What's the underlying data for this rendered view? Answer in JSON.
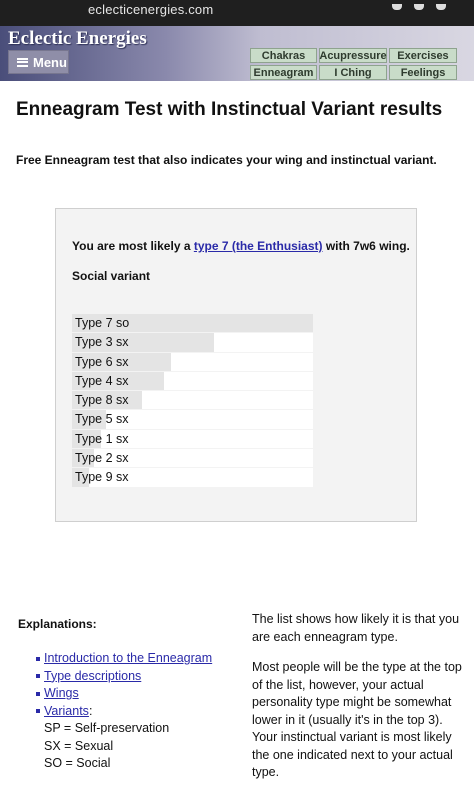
{
  "browser": {
    "url": "eclecticenergies.com"
  },
  "site": {
    "title": "Eclectic Energies",
    "menu_label": "Menu"
  },
  "nav": [
    {
      "label": "Chakras"
    },
    {
      "label": "Acupressure"
    },
    {
      "label": "Exercises"
    },
    {
      "label": "Enneagram"
    },
    {
      "label": "I Ching"
    },
    {
      "label": "Feelings"
    }
  ],
  "page": {
    "title": "Enneagram Test with Instinctual Variant results",
    "subtitle": "Free Enneagram test that also indicates your wing and instinctual variant."
  },
  "result": {
    "prefix": "You are most likely a ",
    "type_link": "type 7 (the Enthusiast)",
    "suffix": " with 7w6 wing.",
    "variant": "Social variant"
  },
  "bars": [
    {
      "label": "Type 7 so",
      "score": 1.0
    },
    {
      "label": "Type 3 sx",
      "score": 0.59
    },
    {
      "label": "Type 6 sx",
      "score": 0.41
    },
    {
      "label": "Type 4 sx",
      "score": 0.38
    },
    {
      "label": "Type 8 sx",
      "score": 0.29
    },
    {
      "label": "Type 5 sx",
      "score": 0.14
    },
    {
      "label": "Type 1 sx",
      "score": 0.12
    },
    {
      "label": "Type 2 sx",
      "score": 0.09
    },
    {
      "label": "Type 9 sx",
      "score": 0.07
    }
  ],
  "explanations": {
    "title": "Explanations:",
    "links": [
      "Introduction to the Enneagram",
      "Type descriptions",
      "Wings",
      "Variants"
    ],
    "variants_suffix": ":",
    "variant_defs": [
      "SP = Self-preservation",
      "SX = Sexual",
      "SO = Social"
    ]
  },
  "side_text": {
    "p1": "The list shows how likely it is that you are each enneagram type.",
    "p2": "Most people will be the type at the top of the list, however, your actual personality type might be somewhat lower in it (usually it's in the top 3). Your instinctual variant is most likely the one indicated next to your actual type."
  }
}
